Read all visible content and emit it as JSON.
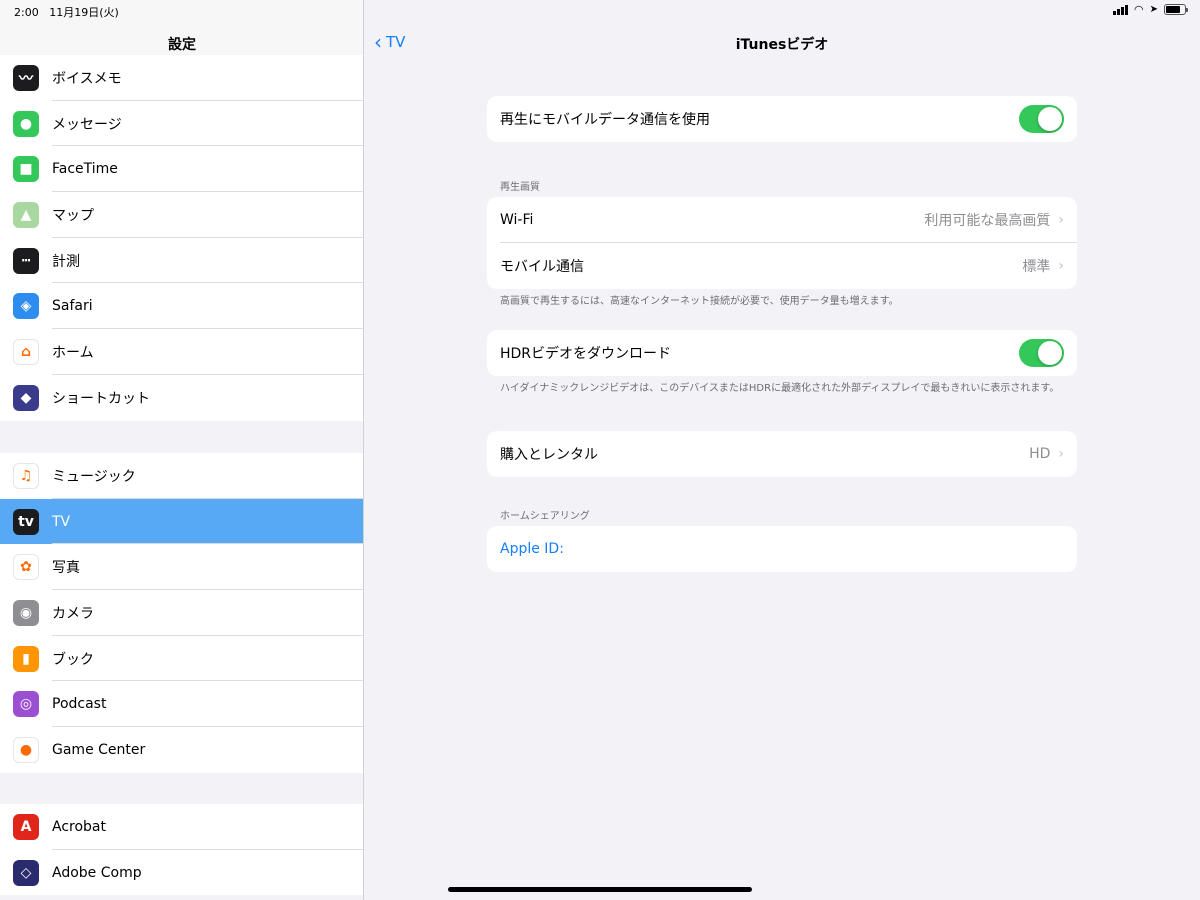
{
  "status": {
    "time": "2:00",
    "date": "11月19日(火)"
  },
  "sidebar": {
    "title": "設定",
    "groups": [
      {
        "items": [
          {
            "label": "ボイスメモ",
            "icon": "voice-memo-icon",
            "color": "#1c1c1e",
            "glyph": "〰"
          },
          {
            "label": "メッセージ",
            "icon": "messages-icon",
            "color": "#34c759",
            "glyph": "●"
          },
          {
            "label": "FaceTime",
            "icon": "facetime-icon",
            "color": "#34c759",
            "glyph": "■"
          },
          {
            "label": "マップ",
            "icon": "maps-icon",
            "color": "#a8d8a0",
            "glyph": "▲"
          },
          {
            "label": "計測",
            "icon": "measure-icon",
            "color": "#1c1c1e",
            "glyph": "┅"
          },
          {
            "label": "Safari",
            "icon": "safari-icon",
            "color": "#2d8cf0",
            "glyph": "◈"
          },
          {
            "label": "ホーム",
            "icon": "home-icon",
            "color": "#ffffff",
            "glyph": "⌂"
          },
          {
            "label": "ショートカット",
            "icon": "shortcuts-icon",
            "color": "#3b3b8c",
            "glyph": "◆"
          }
        ]
      },
      {
        "items": [
          {
            "label": "ミュージック",
            "icon": "music-icon",
            "color": "#ffffff",
            "glyph": "♫"
          },
          {
            "label": "TV",
            "icon": "tv-app-icon",
            "color": "#1c1c1e",
            "glyph": "tv",
            "selected": true
          },
          {
            "label": "写真",
            "icon": "photos-icon",
            "color": "#ffffff",
            "glyph": "✿"
          },
          {
            "label": "カメラ",
            "icon": "camera-icon",
            "color": "#8e8e93",
            "glyph": "◉"
          },
          {
            "label": "ブック",
            "icon": "books-icon",
            "color": "#ff9500",
            "glyph": "▮"
          },
          {
            "label": "Podcast",
            "icon": "podcast-icon",
            "color": "#9b4fd1",
            "glyph": "◎"
          },
          {
            "label": "Game Center",
            "icon": "game-center-icon",
            "color": "#ffffff",
            "glyph": "●"
          }
        ]
      },
      {
        "items": [
          {
            "label": "Acrobat",
            "icon": "acrobat-icon",
            "color": "#e0261b",
            "glyph": "A"
          },
          {
            "label": "Adobe Comp",
            "icon": "adobe-comp-icon",
            "color": "#2a2a6e",
            "glyph": "◇"
          }
        ]
      }
    ]
  },
  "detail": {
    "back_label": "TV",
    "title": "iTunesビデオ",
    "cellular_playback": {
      "label": "再生にモバイルデータ通信を使用",
      "on": true
    },
    "quality_section": "再生画質",
    "wifi": {
      "label": "Wi-Fi",
      "value": "利用可能な最高画質"
    },
    "cellular": {
      "label": "モバイル通信",
      "value": "標準"
    },
    "quality_note": "高画質で再生するには、高速なインターネット接続が必要で、使用データ量も増えます。",
    "hdr_download": {
      "label": "HDRビデオをダウンロード",
      "on": true
    },
    "hdr_note": "ハイダイナミックレンジビデオは、このデバイスまたはHDRに最適化された外部ディスプレイで最もきれいに表示されます。",
    "purchase": {
      "label": "購入とレンタル",
      "value": "HD"
    },
    "home_sharing_section": "ホームシェアリング",
    "apple_id_label": "Apple ID:"
  },
  "colors": {
    "accent": "#147efb",
    "toggle_on": "#34c759",
    "selected_row": "#57a9f5"
  }
}
